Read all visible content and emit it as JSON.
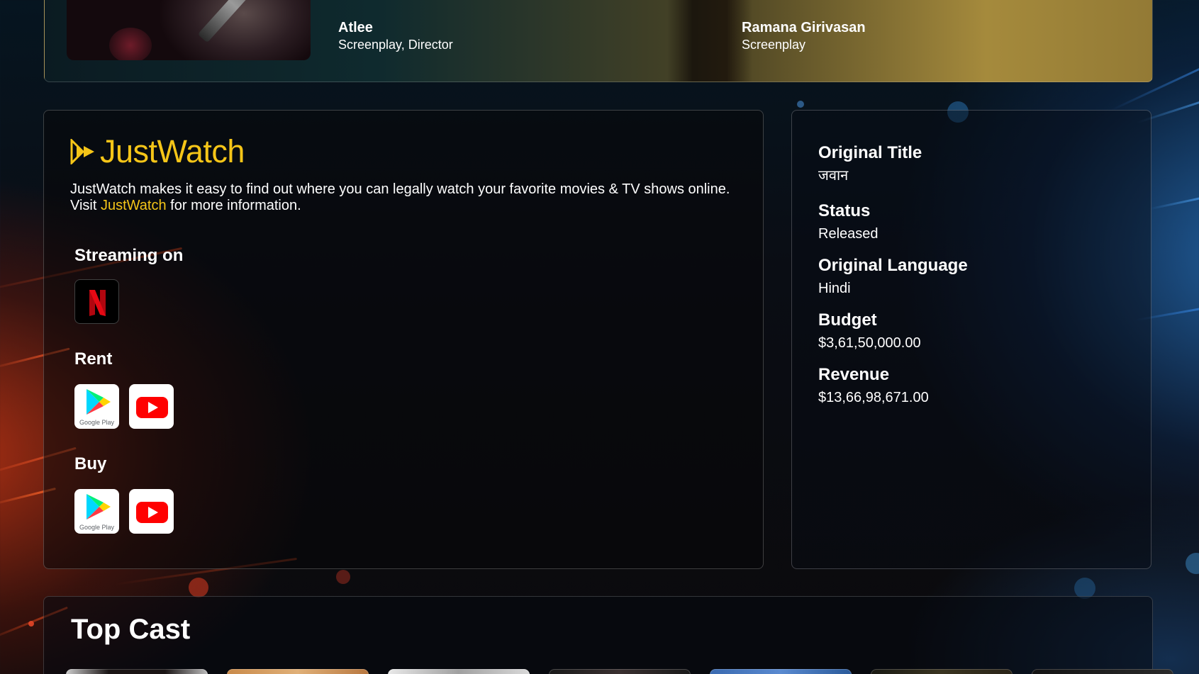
{
  "crew": [
    {
      "name": "Atlee",
      "role": "Screenplay, Director"
    },
    {
      "name": "Ramana Girivasan",
      "role": "Screenplay"
    }
  ],
  "justwatch": {
    "logo_text": "JustWatch",
    "description_before": "JustWatch makes it easy to find out where you can legally watch your favorite movies & TV shows online. Visit ",
    "link_text": "JustWatch",
    "description_after": " for more information.",
    "sections": {
      "streaming": {
        "title": "Streaming on",
        "providers": [
          "netflix-icon"
        ]
      },
      "rent": {
        "title": "Rent",
        "providers": [
          "google-play-icon",
          "youtube-icon"
        ]
      },
      "buy": {
        "title": "Buy",
        "providers": [
          "google-play-icon",
          "youtube-icon"
        ]
      }
    },
    "google_play_label": "Google Play",
    "colors": {
      "accent": "#f5c518",
      "netflix": "#e50914",
      "youtube": "#ff0000"
    }
  },
  "details": {
    "original_title": {
      "label": "Original Title",
      "value": "जवान"
    },
    "status": {
      "label": "Status",
      "value": "Released"
    },
    "original_language": {
      "label": "Original Language",
      "value": "Hindi"
    },
    "budget": {
      "label": "Budget",
      "value": "$3,61,50,000.00"
    },
    "revenue": {
      "label": "Revenue",
      "value": "$13,66,98,671.00"
    }
  },
  "top_cast": {
    "title": "Top Cast"
  }
}
